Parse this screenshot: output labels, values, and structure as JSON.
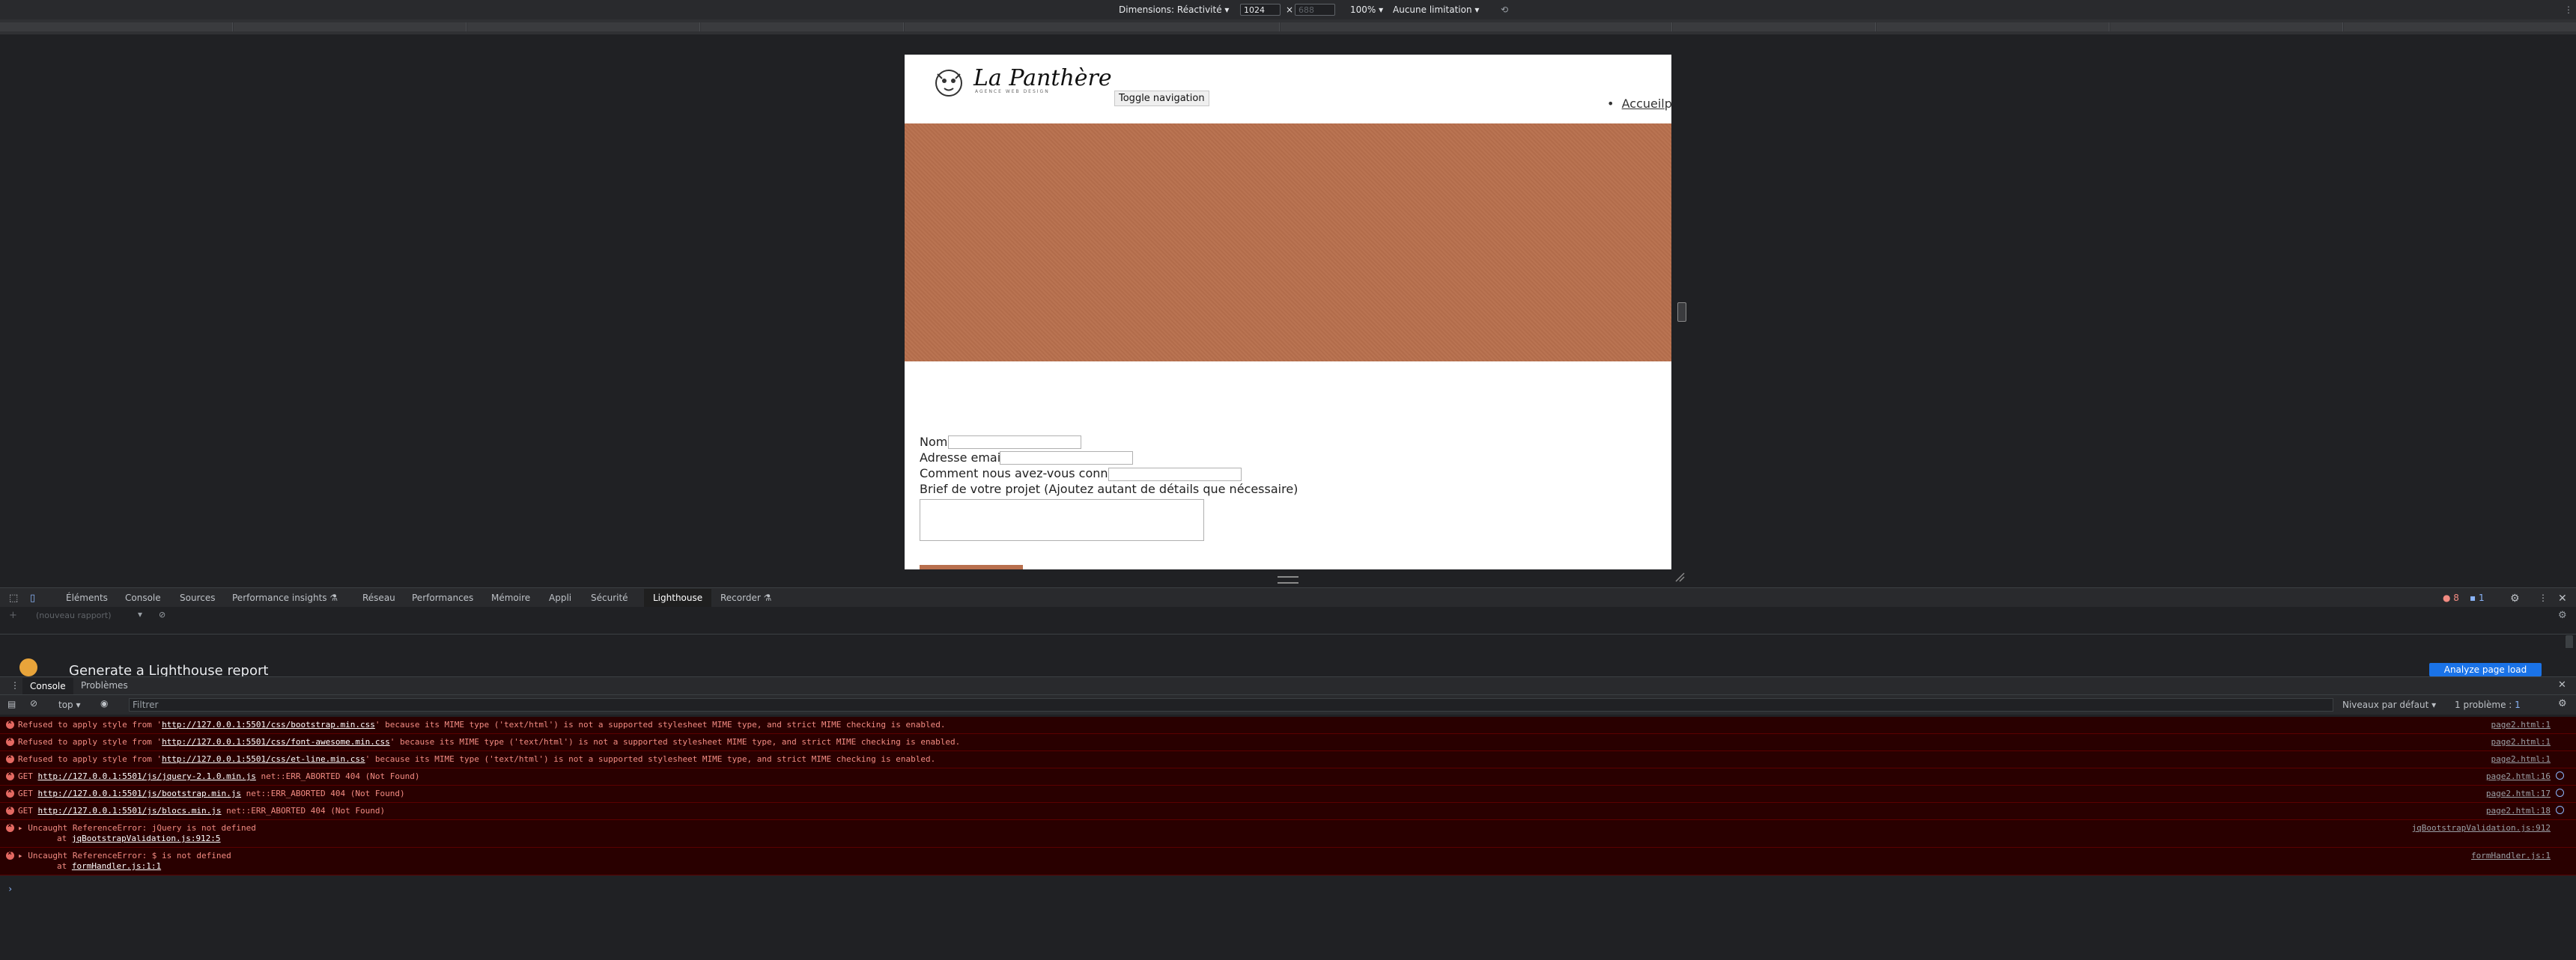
{
  "device_toolbar": {
    "dimensions_label": "Dimensions: Réactivité",
    "width_value": "1024",
    "times": "×",
    "height_placeholder": "688",
    "zoom": "100%",
    "throttle": "Aucune limitation"
  },
  "page": {
    "logo_text": "La Panthère",
    "logo_subtext": "AGENCE WEB DESIGN",
    "toggle_nav_label": "Toggle navigation",
    "nav_bullet": "•",
    "nav_item": "Accueil",
    "nav_item_overflow": "pa",
    "form": {
      "name_label": "Nom",
      "email_label": "Adresse email",
      "referral_label": "Comment nous avez-vous connu ?",
      "brief_label": "Brief de votre projet (Ajoutez autant de détails que nécessaire)"
    },
    "hero_color": "#b86f4d"
  },
  "devtools_tabs": [
    "Éléments",
    "Console",
    "Sources",
    "Performance insights",
    "Réseau",
    "Performances",
    "Mémoire",
    "Appli",
    "Sécurité",
    "Lighthouse",
    "Recorder"
  ],
  "active_tab": "Lighthouse",
  "error_count": "8",
  "info_count": "1",
  "lighthouse": {
    "report_select": "(nouveau rapport)",
    "title": "Generate a Lighthouse report",
    "button": "Analyze page load"
  },
  "drawer": {
    "tabs": [
      "Console",
      "Problèmes"
    ],
    "context": "top",
    "filter_placeholder": "Filtrer",
    "levels": "Niveaux par défaut",
    "issues": "1 problème :",
    "issues_count": "1"
  },
  "messages": [
    {
      "pre": "Refused to apply style from '",
      "url": "http://127.0.0.1:5501/css/bootstrap.min.css",
      "post": "' because its MIME type ('text/html') is not a supported stylesheet MIME type, and strict MIME checking is enabled.",
      "src": "page2.html:1"
    },
    {
      "pre": "Refused to apply style from '",
      "url": "http://127.0.0.1:5501/css/font-awesome.min.css",
      "post": "' because its MIME type ('text/html') is not a supported stylesheet MIME type, and strict MIME checking is enabled.",
      "src": "page2.html:1"
    },
    {
      "pre": "Refused to apply style from '",
      "url": "http://127.0.0.1:5501/css/et-line.min.css",
      "post": "' because its MIME type ('text/html') is not a supported stylesheet MIME type, and strict MIME checking is enabled.",
      "src": "page2.html:1"
    },
    {
      "pre": "GET ",
      "url": "http://127.0.0.1:5501/js/jquery-2.1.0.min.js",
      "post": " net::ERR_ABORTED 404 (Not Found)",
      "src": "page2.html:16"
    },
    {
      "pre": "GET ",
      "url": "http://127.0.0.1:5501/js/bootstrap.min.js",
      "post": " net::ERR_ABORTED 404 (Not Found)",
      "src": "page2.html:17"
    },
    {
      "pre": "GET ",
      "url": "http://127.0.0.1:5501/js/blocs.min.js",
      "post": " net::ERR_ABORTED 404 (Not Found)",
      "src": "page2.html:18"
    },
    {
      "pre": "▸ Uncaught ReferenceError: jQuery is not defined",
      "url": "",
      "post": "",
      "src": "jqBootstrapValidation.js:912",
      "stack_at": "at",
      "stack_link": "jqBootstrapValidation.js:912:5"
    },
    {
      "pre": "▸ Uncaught ReferenceError: $ is not defined",
      "url": "",
      "post": "",
      "src": "formHandler.js:1",
      "stack_at": "at",
      "stack_link": "formHandler.js:1:1"
    }
  ],
  "prompt": "›"
}
